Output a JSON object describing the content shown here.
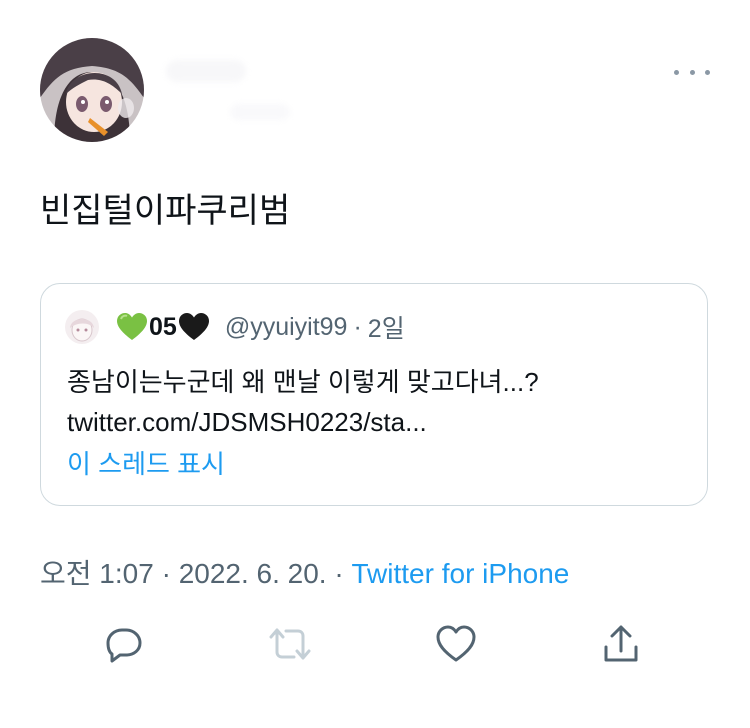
{
  "tweet": {
    "text": "빈집털이파쿠리범"
  },
  "quoted_tweet": {
    "name_text": "05",
    "handle": "@yyuiyit99",
    "separator": "·",
    "time": "2일",
    "text": "종남이는누군데 왜 맨날 이렇게 맞고다녀...?",
    "link": "twitter.com/JDSMSH0223/sta...",
    "show_thread": "이 스레드 표시",
    "icons": [
      "green-heart-icon",
      "black-heart-icon"
    ]
  },
  "meta": {
    "time": "오전 1:07",
    "separator": " · ",
    "date": "2022. 6. 20.",
    "source": "Twitter for iPhone"
  },
  "actions": [
    "reply-icon",
    "retweet-icon",
    "like-icon",
    "share-icon"
  ],
  "colors": {
    "accent": "#1d9bf0",
    "secondary_text": "#536471",
    "border": "#cfd9de",
    "icon": "#536471",
    "retweet_disabled": "#c4cfd6"
  }
}
